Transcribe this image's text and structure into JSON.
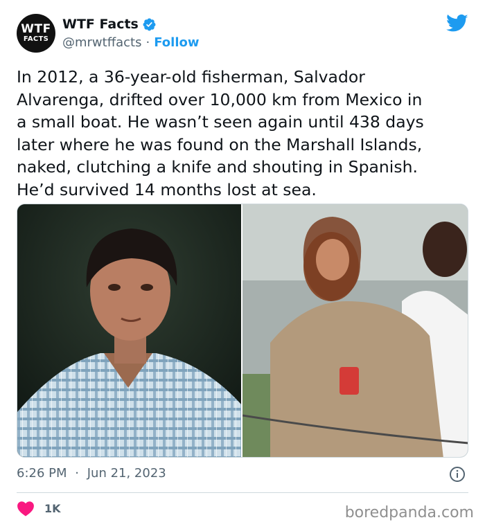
{
  "author": {
    "avatar_line1": "WTF",
    "avatar_line2": "FACTS",
    "name": "WTF Facts",
    "handle": "@mrwtffacts",
    "separator": "·",
    "follow_label": "Follow"
  },
  "tweet": {
    "text": "In 2012, a 36-year-old fisherman, Salvador\nAlvarenga, drifted over 10,000 km from Mexico in\na small boat. He wasn’t seen again until 438 days\nlater where he was found on the Marshall Islands,\nnaked, clutching a knife and shouting in Spanish.\nHe’d survived 14 months lost at sea.",
    "time": "6:26 PM",
    "separator": "·",
    "date": "Jun 21, 2023",
    "like_count": "1K"
  },
  "media": {
    "left_photo": "portrait-photo",
    "right_photo": "rescue-photo"
  },
  "footer": {
    "source": "boredpanda.com"
  },
  "colors": {
    "accent": "#1d9bf0",
    "heart": "#f91880",
    "muted": "#536471",
    "text": "#0f1419"
  },
  "icons": [
    "verified-badge-icon",
    "twitter-bird-icon",
    "info-icon",
    "heart-icon"
  ]
}
